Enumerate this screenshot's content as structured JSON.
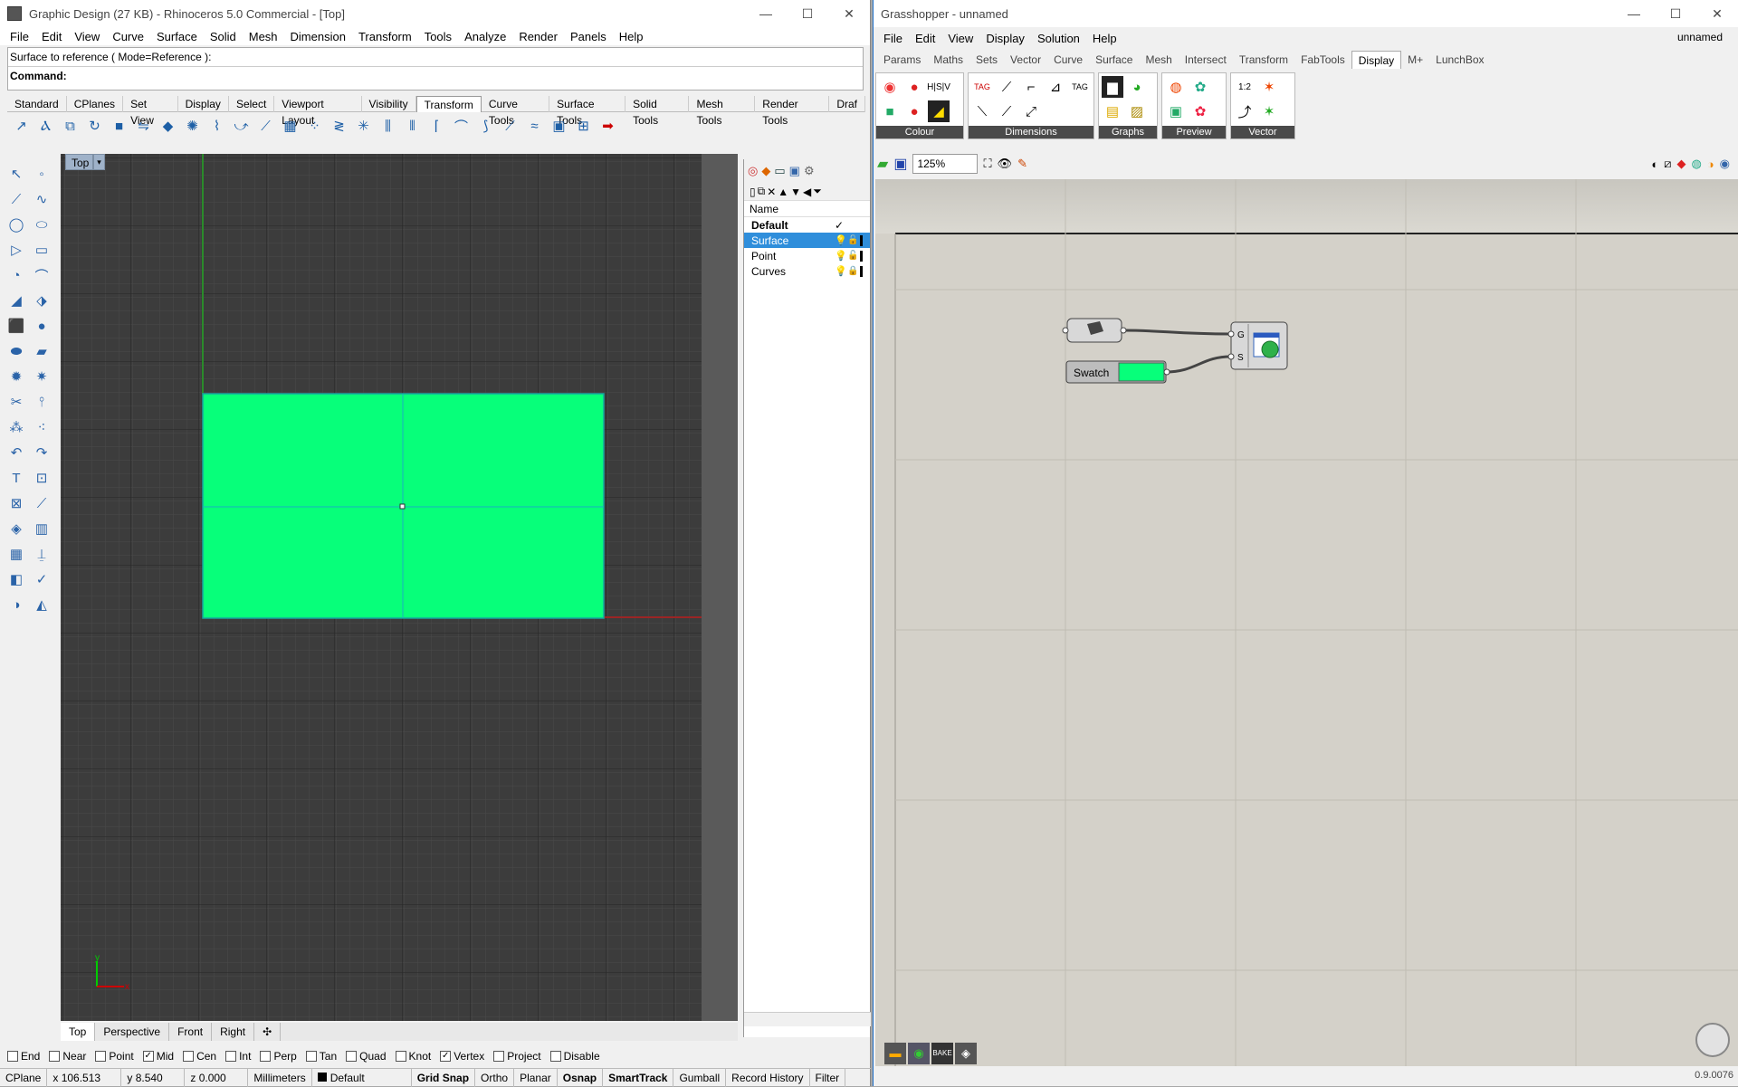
{
  "rhino": {
    "title": "Graphic Design (27 KB) - Rhinoceros 5.0 Commercial - [Top]",
    "menu": [
      "File",
      "Edit",
      "View",
      "Curve",
      "Surface",
      "Solid",
      "Mesh",
      "Dimension",
      "Transform",
      "Tools",
      "Analyze",
      "Render",
      "Panels",
      "Help"
    ],
    "command_history": "Surface to reference ( Mode=Reference ):",
    "command_label": "Command:",
    "toolbar_tabs": [
      "Standard",
      "CPlanes",
      "Set View",
      "Display",
      "Select",
      "Viewport Layout",
      "Visibility",
      "Transform",
      "Curve Tools",
      "Surface Tools",
      "Solid Tools",
      "Mesh Tools",
      "Render Tools",
      "Draf"
    ],
    "active_toolbar_tab": "Transform",
    "viewport": {
      "label": "Top",
      "tabs": [
        "Top",
        "Perspective",
        "Front",
        "Right"
      ],
      "surface_color": "#07ff7a",
      "axis_x": "x",
      "axis_y": "y"
    },
    "layers": {
      "header": "Name",
      "rows": [
        {
          "name": "Default",
          "current": "✓"
        },
        {
          "name": "Surface",
          "selected": true
        },
        {
          "name": "Point"
        },
        {
          "name": "Curves"
        }
      ]
    },
    "osnap": [
      {
        "label": "End",
        "checked": false
      },
      {
        "label": "Near",
        "checked": false
      },
      {
        "label": "Point",
        "checked": false
      },
      {
        "label": "Mid",
        "checked": true
      },
      {
        "label": "Cen",
        "checked": false
      },
      {
        "label": "Int",
        "checked": false
      },
      {
        "label": "Perp",
        "checked": false
      },
      {
        "label": "Tan",
        "checked": false
      },
      {
        "label": "Quad",
        "checked": false
      },
      {
        "label": "Knot",
        "checked": false
      },
      {
        "label": "Vertex",
        "checked": true
      },
      {
        "label": "Project",
        "checked": false
      },
      {
        "label": "Disable",
        "checked": false
      }
    ],
    "status": {
      "cplane": "CPlane",
      "x": "x 106.513",
      "y": "y 8.540",
      "z": "z 0.000",
      "units": "Millimeters",
      "layer": "Default",
      "toggles": [
        "Grid Snap",
        "Ortho",
        "Planar",
        "Osnap",
        "SmartTrack",
        "Gumball",
        "Record History",
        "Filter"
      ]
    }
  },
  "grasshopper": {
    "title": "Grasshopper - unnamed",
    "doc_name": "unnamed",
    "menu": [
      "File",
      "Edit",
      "View",
      "Display",
      "Solution",
      "Help"
    ],
    "tabs": [
      "Params",
      "Maths",
      "Sets",
      "Vector",
      "Curve",
      "Surface",
      "Mesh",
      "Intersect",
      "Transform",
      "FabTools",
      "Display",
      "M+",
      "LunchBox"
    ],
    "active_tab": "Display",
    "groups": [
      "Colour",
      "Dimensions",
      "Graphs",
      "Preview",
      "Vector"
    ],
    "zoom": "125%",
    "swatch_label": "Swatch",
    "swatch_color": "#07ff7a",
    "preview_inputs": [
      "G",
      "S"
    ],
    "version": "0.9.0076"
  }
}
